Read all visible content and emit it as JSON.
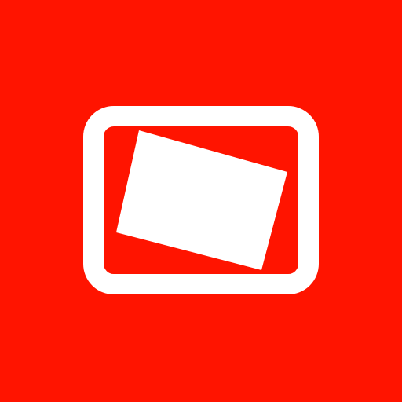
{
  "icon": {
    "name": "photo-in-frame-icon",
    "colors": {
      "background": "#ff1400",
      "foreground": "#ffffff"
    }
  }
}
